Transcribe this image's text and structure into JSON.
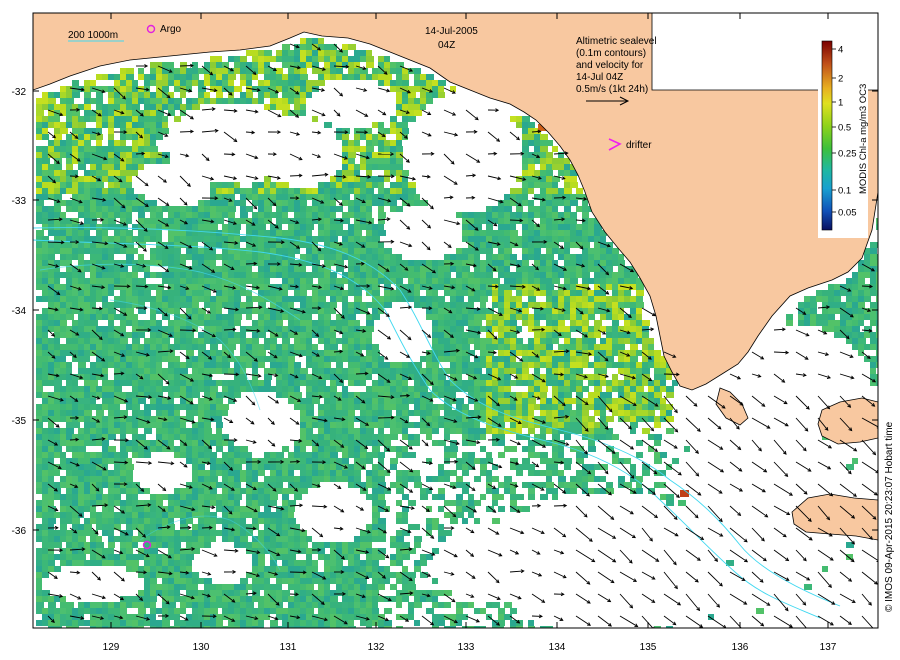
{
  "title": {
    "date": "14-Jul-2005",
    "time": "04Z"
  },
  "scale_bar": {
    "label": "200  1000m"
  },
  "argo": {
    "label": "Argo"
  },
  "altimetry_note": {
    "line1": "Altimetric sealevel",
    "line2": "(0.1m contours)",
    "line3": "and velocity for",
    "line4": "14-Jul 04Z",
    "line5": "0.5m/s (1kt 24h)"
  },
  "drifter": {
    "label": "drifter"
  },
  "colorbar": {
    "title": "MODIS Chl-a mg/m3 OC3",
    "ticks": [
      "4",
      "2",
      "1",
      "0.5",
      "0.25",
      "0.1",
      "0.05"
    ],
    "colors": [
      "#7a0000",
      "#c0501a",
      "#e8a020",
      "#e8e020",
      "#9ad21a",
      "#3cc03c",
      "#20b890",
      "#18a0c8",
      "#1060c0",
      "#0a1a80"
    ]
  },
  "credit": "© IMOS 09-Apr-2015 20:23:07 Hobart time",
  "axes": {
    "lon_ticks": [
      "129",
      "130",
      "131",
      "132",
      "133",
      "134",
      "135",
      "136",
      "137"
    ],
    "lat_ticks": [
      "-32",
      "-33",
      "-34",
      "-35",
      "-36"
    ]
  },
  "colors": {
    "land": "#f8c8a0",
    "ocean_chl": "#40b878",
    "contour": "#40d8f0",
    "argo": "#e020e0",
    "drifter": "#f020f0",
    "frame": "#000000"
  }
}
